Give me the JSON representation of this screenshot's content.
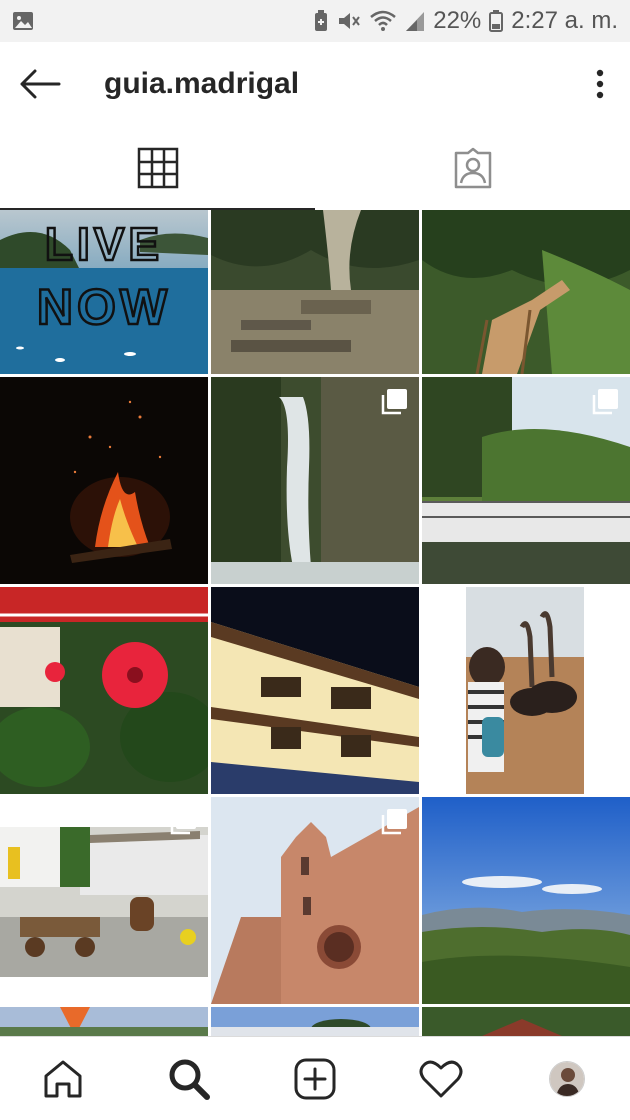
{
  "status_bar": {
    "battery_percent": "22%",
    "time": "2:27 a. m.",
    "icons": [
      "image-icon",
      "battery-saver-icon",
      "mute-icon",
      "wifi-icon",
      "signal-icon",
      "battery-icon"
    ]
  },
  "header": {
    "username": "guia.madrigal",
    "icons": [
      "back-arrow-icon",
      "more-options-icon"
    ]
  },
  "tabs": [
    {
      "name": "grid-tab",
      "icon": "grid-icon",
      "active": true
    },
    {
      "name": "tagged-tab",
      "icon": "tagged-person-icon",
      "active": false
    }
  ],
  "posts": {
    "live_now_text_line1": "LIVE",
    "live_now_text_line2": "NOW",
    "multi_photo_posts": [
      4,
      5,
      9,
      10
    ]
  },
  "bottom_nav": {
    "icons": [
      "home-icon",
      "search-icon",
      "new-post-icon",
      "activity-heart-icon",
      "profile-avatar-icon"
    ],
    "active": "search-icon"
  }
}
